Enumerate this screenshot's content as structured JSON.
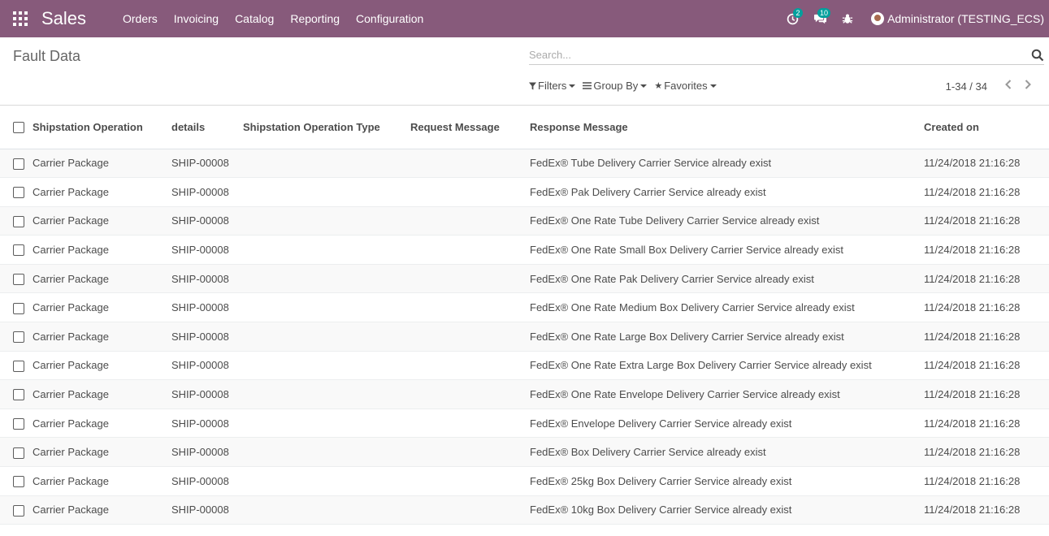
{
  "navbar": {
    "brand": "Sales",
    "menu": [
      "Orders",
      "Invoicing",
      "Catalog",
      "Reporting",
      "Configuration"
    ],
    "activity_badge": "2",
    "messages_badge": "10",
    "user": "Administrator (TESTING_ECS)",
    "background_color": "#875a7b",
    "badge_color": "#00a09d"
  },
  "control_panel": {
    "title": "Fault Data",
    "search_placeholder": "Search...",
    "filters_label": "Filters",
    "group_by_label": "Group By",
    "favorites_label": "Favorites",
    "pager_value": "1-34 / 34"
  },
  "table": {
    "columns": [
      "Shipstation Operation",
      "details",
      "Shipstation Operation Type",
      "Request Message",
      "Response Message",
      "Created on"
    ],
    "rows": [
      {
        "operation": "Carrier Package",
        "details": "SHIP-00008",
        "type": "",
        "request": "",
        "response": "FedEx® Tube Delivery Carrier Service already exist",
        "created": "11/24/2018 21:16:28"
      },
      {
        "operation": "Carrier Package",
        "details": "SHIP-00008",
        "type": "",
        "request": "",
        "response": "FedEx® Pak Delivery Carrier Service already exist",
        "created": "11/24/2018 21:16:28"
      },
      {
        "operation": "Carrier Package",
        "details": "SHIP-00008",
        "type": "",
        "request": "",
        "response": "FedEx® One Rate Tube Delivery Carrier Service already exist",
        "created": "11/24/2018 21:16:28"
      },
      {
        "operation": "Carrier Package",
        "details": "SHIP-00008",
        "type": "",
        "request": "",
        "response": "FedEx® One Rate Small Box Delivery Carrier Service already exist",
        "created": "11/24/2018 21:16:28"
      },
      {
        "operation": "Carrier Package",
        "details": "SHIP-00008",
        "type": "",
        "request": "",
        "response": "FedEx® One Rate Pak Delivery Carrier Service already exist",
        "created": "11/24/2018 21:16:28"
      },
      {
        "operation": "Carrier Package",
        "details": "SHIP-00008",
        "type": "",
        "request": "",
        "response": "FedEx® One Rate Medium Box Delivery Carrier Service already exist",
        "created": "11/24/2018 21:16:28"
      },
      {
        "operation": "Carrier Package",
        "details": "SHIP-00008",
        "type": "",
        "request": "",
        "response": "FedEx® One Rate Large Box Delivery Carrier Service already exist",
        "created": "11/24/2018 21:16:28"
      },
      {
        "operation": "Carrier Package",
        "details": "SHIP-00008",
        "type": "",
        "request": "",
        "response": "FedEx® One Rate Extra Large Box Delivery Carrier Service already exist",
        "created": "11/24/2018 21:16:28"
      },
      {
        "operation": "Carrier Package",
        "details": "SHIP-00008",
        "type": "",
        "request": "",
        "response": "FedEx® One Rate Envelope Delivery Carrier Service already exist",
        "created": "11/24/2018 21:16:28"
      },
      {
        "operation": "Carrier Package",
        "details": "SHIP-00008",
        "type": "",
        "request": "",
        "response": "FedEx® Envelope Delivery Carrier Service already exist",
        "created": "11/24/2018 21:16:28"
      },
      {
        "operation": "Carrier Package",
        "details": "SHIP-00008",
        "type": "",
        "request": "",
        "response": "FedEx® Box Delivery Carrier Service already exist",
        "created": "11/24/2018 21:16:28"
      },
      {
        "operation": "Carrier Package",
        "details": "SHIP-00008",
        "type": "",
        "request": "",
        "response": "FedEx® 25kg Box Delivery Carrier Service already exist",
        "created": "11/24/2018 21:16:28"
      },
      {
        "operation": "Carrier Package",
        "details": "SHIP-00008",
        "type": "",
        "request": "",
        "response": "FedEx® 10kg Box Delivery Carrier Service already exist",
        "created": "11/24/2018 21:16:28"
      }
    ]
  }
}
